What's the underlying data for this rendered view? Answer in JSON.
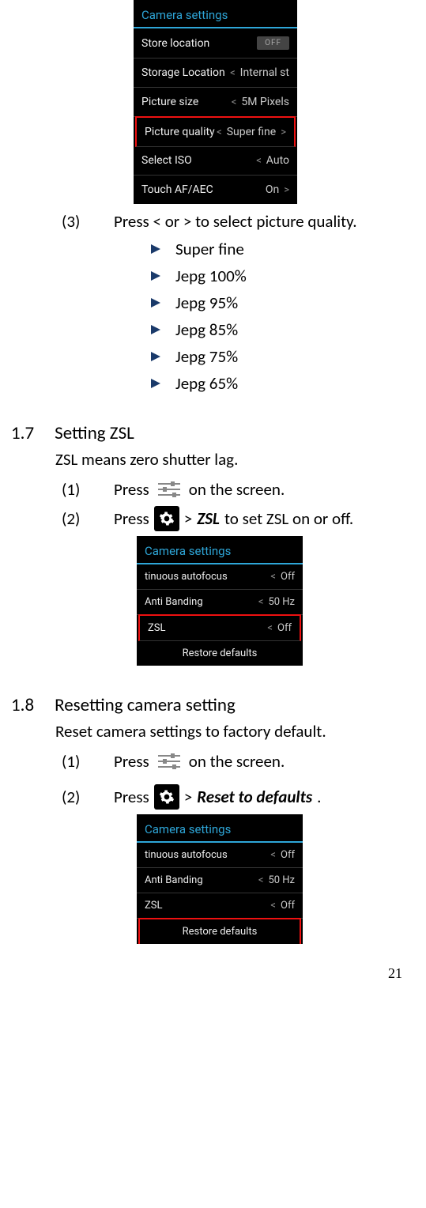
{
  "shot1": {
    "title": "Camera settings",
    "rows": [
      {
        "label": "Store location",
        "type": "toggle",
        "value": "OFF"
      },
      {
        "label": "Storage Location",
        "type": "sel",
        "left": "<",
        "value": "Internal st"
      },
      {
        "label": "Picture size",
        "type": "sel",
        "left": "<",
        "value": "5M Pixels"
      },
      {
        "label": "Picture quality",
        "type": "sel",
        "left": "<",
        "value": "Super fine",
        "right": ">",
        "highlight": true
      },
      {
        "label": "Select ISO",
        "type": "sel",
        "left": "<",
        "value": "Auto"
      },
      {
        "label": "Touch AF/AEC",
        "type": "sel",
        "value": "On",
        "right": ">"
      }
    ]
  },
  "step3": {
    "num": "(3)",
    "text": "Press < or > to select picture quality."
  },
  "bullets": [
    "Super fine",
    "Jepg 100%",
    "Jepg 95%",
    "Jepg 85%",
    "Jepg 75%",
    "Jepg 65%"
  ],
  "sec17": {
    "num": "1.7",
    "title": "Setting ZSL",
    "sub": "ZSL means zero shutter lag.",
    "step1": {
      "num": "(1)",
      "pre": "Press",
      "post": "on the screen."
    },
    "step2": {
      "num": "(2)",
      "pre": "Press",
      "mid": ">",
      "bold": "ZSL",
      "post": "to set ZSL on or off."
    }
  },
  "shot2": {
    "title": "Camera settings",
    "rows": [
      {
        "label": "tinuous autofocus",
        "type": "sel",
        "left": "<",
        "value": "Off"
      },
      {
        "label": "Anti Banding",
        "type": "sel",
        "left": "<",
        "value": "50 Hz"
      },
      {
        "label": "ZSL",
        "type": "sel",
        "left": "<",
        "value": "Off",
        "highlight": true
      },
      {
        "label": "Restore defaults",
        "type": "center"
      }
    ]
  },
  "sec18": {
    "num": "1.8",
    "title": "Resetting camera setting",
    "sub": "Reset camera settings to factory default.",
    "step1": {
      "num": "(1)",
      "pre": "Press",
      "post": "on the screen."
    },
    "step2": {
      "num": "(2)",
      "pre": "Press",
      "mid": ">",
      "bold": "Reset to defaults",
      "post": "."
    }
  },
  "shot3": {
    "title": "Camera settings",
    "rows": [
      {
        "label": "tinuous autofocus",
        "type": "sel",
        "left": "<",
        "value": "Off"
      },
      {
        "label": "Anti Banding",
        "type": "sel",
        "left": "<",
        "value": "50 Hz"
      },
      {
        "label": "ZSL",
        "type": "sel",
        "left": "<",
        "value": "Off"
      },
      {
        "label": "Restore defaults",
        "type": "center",
        "highlight": true
      }
    ]
  },
  "page_number": "21"
}
